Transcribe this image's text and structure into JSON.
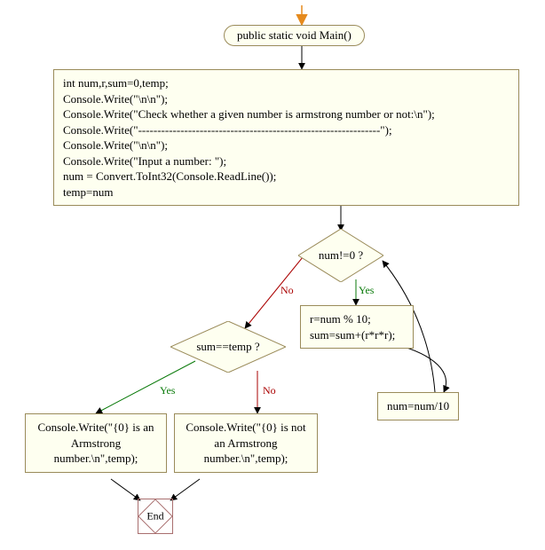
{
  "start": {
    "label": "public static void Main()"
  },
  "init_block": {
    "l1": "int num,r,sum=0,temp;",
    "l2": "Console.Write(\"\\n\\n\");",
    "l3": "Console.Write(\"Check whether a given number is armstrong number or not:\\n\");",
    "l4": "Console.Write(\"---------------------------------------------------------------\");",
    "l5": "Console.Write(\"\\n\\n\");",
    "l6": "Console.Write(\"Input  a number: \");",
    "l7": "num = Convert.ToInt32(Console.ReadLine());",
    "l8": "temp=num"
  },
  "decision_loop": {
    "label": "num!=0 ?"
  },
  "loop_body": {
    "l1": "r=num % 10;",
    "l2": "sum=sum+(r*r*r);"
  },
  "loop_step": {
    "label": "num=num/10"
  },
  "decision_result": {
    "label": "sum==temp ?"
  },
  "result_yes": {
    "text": "Console.Write(\"{0} is an Armstrong number.\\n\",temp);"
  },
  "result_no": {
    "text": "Console.Write(\"{0} is not an Armstrong number.\\n\",temp);"
  },
  "end": {
    "label": "End"
  },
  "edges": {
    "yes": "Yes",
    "no": "No"
  },
  "chart_data": {
    "type": "flowchart",
    "nodes": [
      {
        "id": "start",
        "shape": "rounded",
        "label": "public static void Main()"
      },
      {
        "id": "init",
        "shape": "process",
        "code": [
          "int num,r,sum=0,temp;",
          "Console.Write(\"\\n\\n\");",
          "Console.Write(\"Check whether a given number is armstrong number or not:\\n\");",
          "Console.Write(\"---------------------------------------------------------------\");",
          "Console.Write(\"\\n\\n\");",
          "Console.Write(\"Input  a number: \");",
          "num = Convert.ToInt32(Console.ReadLine());",
          "temp=num"
        ]
      },
      {
        "id": "d1",
        "shape": "decision",
        "label": "num!=0 ?"
      },
      {
        "id": "body",
        "shape": "process",
        "code": [
          "r=num % 10;",
          "sum=sum+(r*r*r);"
        ]
      },
      {
        "id": "step",
        "shape": "process",
        "code": [
          "num=num/10"
        ]
      },
      {
        "id": "d2",
        "shape": "decision",
        "label": "sum==temp ?"
      },
      {
        "id": "resY",
        "shape": "process",
        "code": [
          "Console.Write(\"{0} is an Armstrong number.\\n\",temp);"
        ]
      },
      {
        "id": "resN",
        "shape": "process",
        "code": [
          "Console.Write(\"{0} is not an Armstrong number.\\n\",temp);"
        ]
      },
      {
        "id": "end",
        "shape": "terminator",
        "label": "End"
      }
    ],
    "edges": [
      {
        "from": "start",
        "to": "init"
      },
      {
        "from": "init",
        "to": "d1"
      },
      {
        "from": "d1",
        "to": "body",
        "label": "Yes"
      },
      {
        "from": "body",
        "to": "step"
      },
      {
        "from": "step",
        "to": "d1"
      },
      {
        "from": "d1",
        "to": "d2",
        "label": "No"
      },
      {
        "from": "d2",
        "to": "resY",
        "label": "Yes"
      },
      {
        "from": "d2",
        "to": "resN",
        "label": "No"
      },
      {
        "from": "resY",
        "to": "end"
      },
      {
        "from": "resN",
        "to": "end"
      }
    ]
  }
}
